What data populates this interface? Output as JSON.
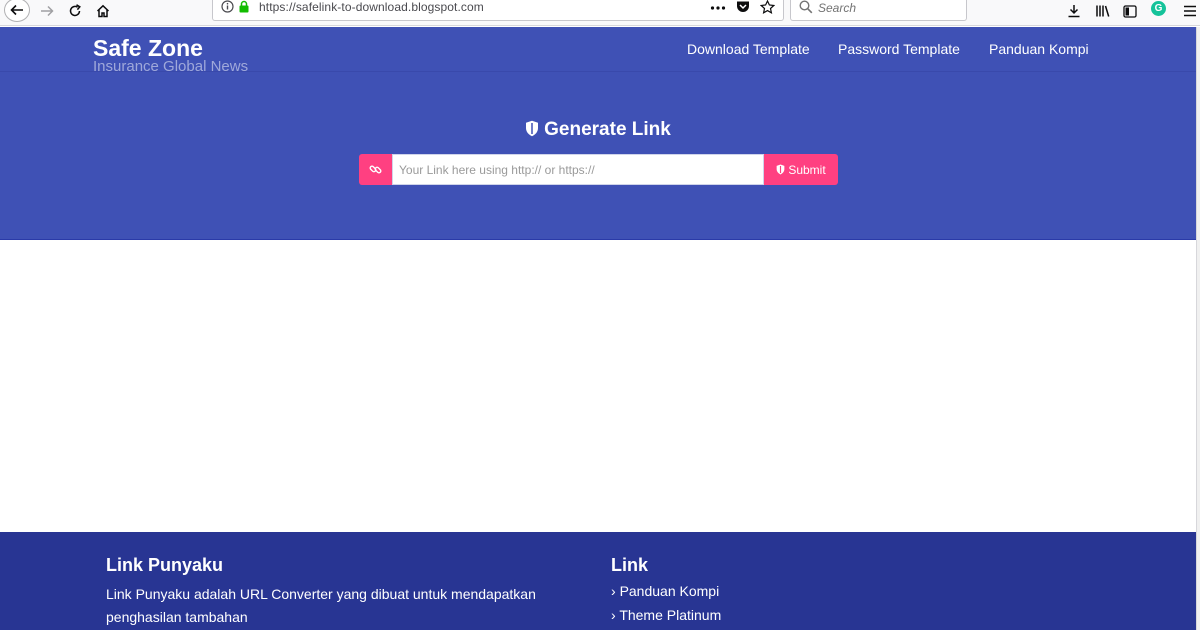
{
  "browser": {
    "url": "https://safelink-to-download.blogspot.com",
    "search_placeholder": "Search",
    "grammarly_letter": "G"
  },
  "header": {
    "brand_title": "Safe Zone",
    "brand_subtitle": "Insurance Global News",
    "nav": [
      {
        "label": "Download Template"
      },
      {
        "label": "Password Template"
      },
      {
        "label": "Panduan Kompi"
      }
    ]
  },
  "generator": {
    "title": "Generate Link",
    "input_placeholder": "Your Link here using http:// or https://",
    "submit_label": "Submit"
  },
  "footer": {
    "about": {
      "heading": "Link Punyaku",
      "description": "Link Punyaku adalah URL Converter yang dibuat untuk mendapatkan penghasilan tambahan"
    },
    "links": {
      "heading": "Link",
      "items": [
        {
          "label": "Panduan Kompi"
        },
        {
          "label": "Theme Platinum"
        }
      ]
    }
  },
  "colors": {
    "header_bg": "#3f51b5",
    "accent": "#ff4081",
    "footer_bg": "#283593"
  },
  "icons": [
    "back-arrow-icon",
    "forward-arrow-icon",
    "reload-icon",
    "home-icon",
    "info-icon",
    "lock-icon",
    "more-icon",
    "pocket-icon",
    "bookmark-star-icon",
    "search-icon",
    "download-icon",
    "library-icon",
    "sidebar-icon",
    "menu-icon",
    "shield-icon",
    "link-icon",
    "chevron-right-icon"
  ]
}
